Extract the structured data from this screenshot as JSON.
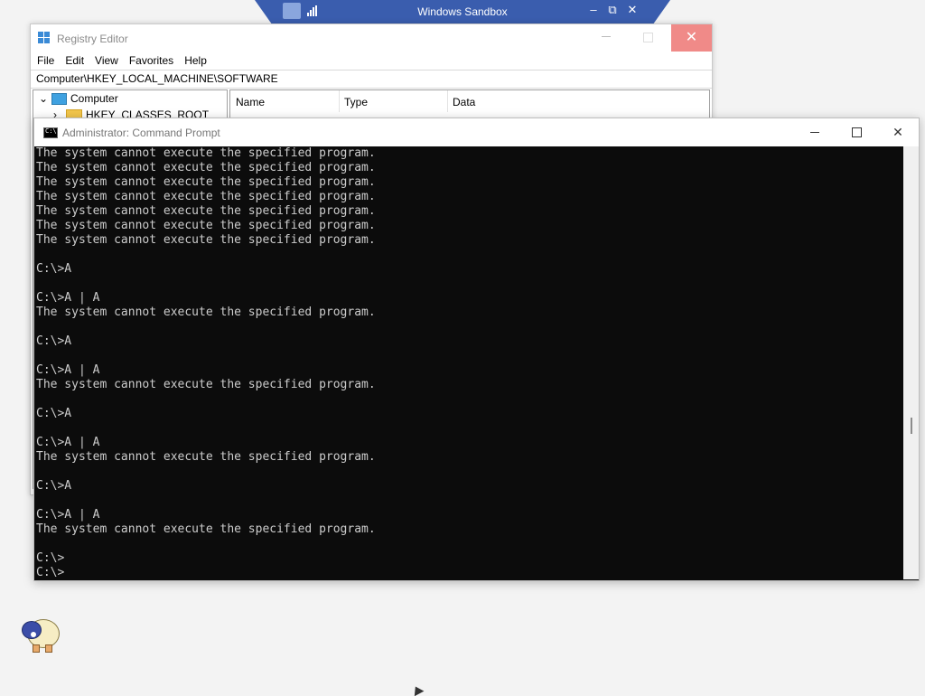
{
  "sandbox": {
    "title": "Windows Sandbox",
    "minimize_label": "–",
    "restore_label": "⧉",
    "close_label": "✕"
  },
  "regedit": {
    "title": "Registry Editor",
    "menu": [
      "File",
      "Edit",
      "View",
      "Favorites",
      "Help"
    ],
    "address": "Computer\\HKEY_LOCAL_MACHINE\\SOFTWARE",
    "tree": [
      {
        "label": "Computer",
        "expander": "⌄",
        "icon": "computer-icon"
      },
      {
        "label": "HKEY_CLASSES_ROOT",
        "expander": "›",
        "icon": "folder-icon"
      }
    ],
    "columns": [
      "Name",
      "Type",
      "Data"
    ],
    "close_label": "✕"
  },
  "cmd": {
    "title": "Administrator: Command Prompt",
    "icon_text": "C:\\",
    "minimize_label": "",
    "maximize_label": "",
    "close_label": "✕",
    "lines": [
      "The system cannot execute the specified program.",
      "The system cannot execute the specified program.",
      "The system cannot execute the specified program.",
      "The system cannot execute the specified program.",
      "The system cannot execute the specified program.",
      "The system cannot execute the specified program.",
      "The system cannot execute the specified program.",
      "",
      "C:\\>A",
      "",
      "C:\\>A | A",
      "The system cannot execute the specified program.",
      "",
      "C:\\>A",
      "",
      "C:\\>A | A",
      "The system cannot execute the specified program.",
      "",
      "C:\\>A",
      "",
      "C:\\>A | A",
      "The system cannot execute the specified program.",
      "",
      "C:\\>A",
      "",
      "C:\\>A | A",
      "The system cannot execute the specified program.",
      "",
      "C:\\>",
      "C:\\>"
    ]
  },
  "colors": {
    "sandbox_bar": "#3a5dae",
    "console_bg": "#0c0c0c",
    "console_fg": "#cccccc",
    "close_hover": "#f08a88"
  },
  "icons": {
    "desktop_mascot": "sheep-mascot-icon",
    "cursor": "mouse-pointer-icon"
  }
}
